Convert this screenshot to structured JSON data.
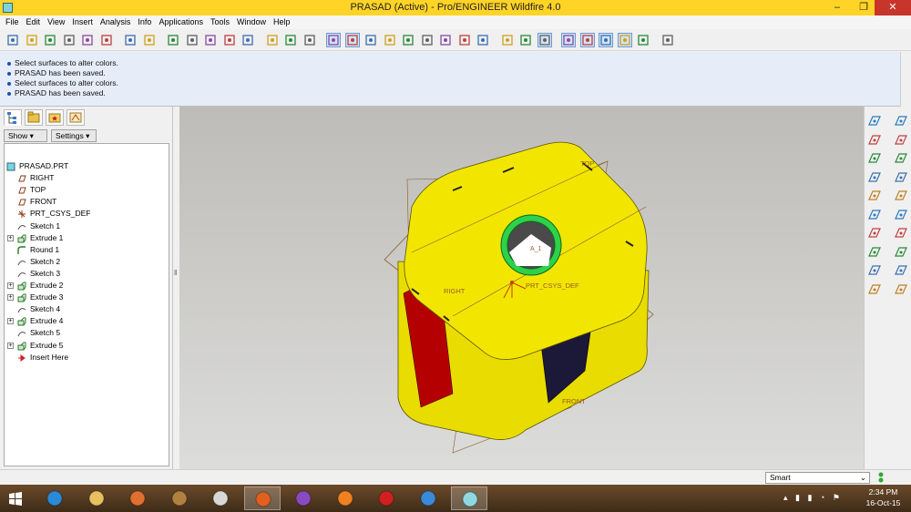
{
  "window": {
    "title": "PRASAD (Active) - Pro/ENGINEER Wildfire 4.0",
    "minimize": "–",
    "restore": "❐",
    "close": "✕"
  },
  "menu": [
    "File",
    "Edit",
    "View",
    "Insert",
    "Analysis",
    "Info",
    "Applications",
    "Tools",
    "Window",
    "Help"
  ],
  "toolbar_icons": [
    "new-icon",
    "open-icon",
    "save-icon",
    "print-icon",
    "print-preview-icon",
    "email-icon",
    "undo-icon",
    "redo-icon",
    "cut-icon",
    "copy-icon",
    "paste-icon",
    "paste-special-icon",
    "regenerate-icon",
    "find-icon",
    "selection-box-icon",
    "repaint-icon",
    "orient-mode-icon",
    "spin-center-icon",
    "zoom-in-icon",
    "zoom-out-icon",
    "refit-icon",
    "reorient-icon",
    "saved-views-icon",
    "layers-icon",
    "wireframe-icon",
    "hidden-line-icon",
    "no-hidden-icon",
    "shading-icon",
    "datum-planes-icon",
    "datum-axes-icon",
    "datum-points-icon",
    "coordinate-systems-icon",
    "annotation-icon",
    "context-help-icon"
  ],
  "messages": [
    "Select surfaces to alter colors.",
    "PRASAD has been saved.",
    "Select surfaces to alter colors.",
    "PRASAD has been saved."
  ],
  "navigator": {
    "tabs": [
      "model-tree-tab",
      "folder-browser-tab",
      "favorites-tab",
      "connections-tab"
    ],
    "show_label": "Show",
    "settings_label": "Settings",
    "tree": [
      {
        "label": "PRASAD.PRT",
        "icon": "part-icon",
        "expandable": false,
        "indent": 0
      },
      {
        "label": "RIGHT",
        "icon": "datum-plane-icon",
        "expandable": false,
        "indent": 1
      },
      {
        "label": "TOP",
        "icon": "datum-plane-icon",
        "expandable": false,
        "indent": 1
      },
      {
        "label": "FRONT",
        "icon": "datum-plane-icon",
        "expandable": false,
        "indent": 1
      },
      {
        "label": "PRT_CSYS_DEF",
        "icon": "csys-icon",
        "expandable": false,
        "indent": 1
      },
      {
        "label": "Sketch 1",
        "icon": "sketch-icon",
        "expandable": false,
        "indent": 1
      },
      {
        "label": "Extrude 1",
        "icon": "extrude-icon",
        "expandable": true,
        "indent": 1
      },
      {
        "label": "Round 1",
        "icon": "round-icon",
        "expandable": false,
        "indent": 1
      },
      {
        "label": "Sketch 2",
        "icon": "sketch-icon",
        "expandable": false,
        "indent": 1
      },
      {
        "label": "Sketch 3",
        "icon": "sketch-icon",
        "expandable": false,
        "indent": 1
      },
      {
        "label": "Extrude 2",
        "icon": "extrude-icon",
        "expandable": true,
        "indent": 1
      },
      {
        "label": "Extrude 3",
        "icon": "extrude-icon",
        "expandable": true,
        "indent": 1
      },
      {
        "label": "Sketch 4",
        "icon": "sketch-icon",
        "expandable": false,
        "indent": 1
      },
      {
        "label": "Extrude 4",
        "icon": "extrude-icon",
        "expandable": true,
        "indent": 1
      },
      {
        "label": "Sketch 5",
        "icon": "sketch-icon",
        "expandable": false,
        "indent": 1
      },
      {
        "label": "Extrude 5",
        "icon": "extrude-icon",
        "expandable": true,
        "indent": 1
      },
      {
        "label": "Insert Here",
        "icon": "insert-arrow-icon",
        "expandable": false,
        "indent": 1
      }
    ]
  },
  "viewport": {
    "labels": {
      "top": "TOP",
      "right": "RIGHT",
      "front": "FRONT",
      "csys": "PRT_CSYS_DEF",
      "axis": "A_1"
    },
    "colors": {
      "body": "#f2e600",
      "body_shadow": "#c9bf00",
      "red_face": "#b40000",
      "dark_face": "#1c1838",
      "ring": "#2ed14a",
      "datum": "#8b5a2b"
    }
  },
  "right_toolbar_icons": [
    "datum-plane-tool-icon",
    "datum-axis-tool-icon",
    "datum-curve-tool-icon",
    "datum-point-tool-icon",
    "csys-tool-icon",
    "sketch-tool-icon",
    "extrude-tool-icon",
    "revolve-tool-icon",
    "sweep-tool-icon",
    "blend-tool-icon",
    "hole-tool-icon",
    "shell-tool-icon",
    "rib-tool-icon",
    "draft-tool-icon",
    "round-tool-icon",
    "chamfer-tool-icon",
    "pattern-tool-icon",
    "mirror-tool-icon",
    "merge-tool-icon",
    "trim-tool-icon"
  ],
  "status": {
    "filter_value": "Smart"
  },
  "taskbar": {
    "apps": [
      "start-icon",
      "internet-explorer-icon",
      "file-explorer-icon",
      "media-player-icon",
      "game-icon",
      "chrome-icon",
      "firefox-icon",
      "visual-studio-icon",
      "vlc-icon",
      "opera-icon",
      "thunderbird-icon",
      "proengineer-icon"
    ],
    "time": "2:34 PM",
    "date": "16-Oct-15"
  }
}
